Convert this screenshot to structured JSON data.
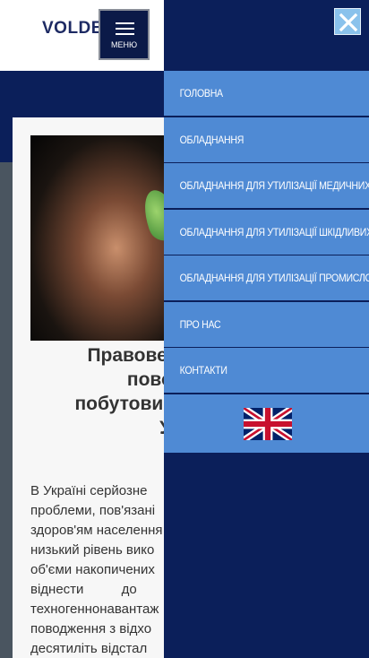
{
  "header": {
    "logo_text": "VOLDEMCA",
    "menu_label": "МЕНЮ"
  },
  "article": {
    "title_lines": [
      "Правове регулювання",
      "поводження з",
      "побутовими відходами в",
      "Україні"
    ],
    "body_lines": [
      "В Україні серйозне",
      "проблеми, пов'язані",
      "здоров'ям населення",
      "низький рівень вико",
      "об'єми накопичених",
      "віднести до",
      "техногеннонавантаж",
      "поводження з відхо",
      "десятиліть відстал"
    ]
  },
  "drawer": {
    "close_icon": "close-icon",
    "items": [
      {
        "label": "ГОЛОВНА"
      },
      {
        "label": "ОБЛАДНАННЯ"
      },
      {
        "label": "ОБЛАДНАННЯ ДЛЯ УТИЛІЗАЦІЇ МЕДИЧНИХ ВІДХОДІВ"
      },
      {
        "label": "ОБЛАДНАННЯ ДЛЯ УТИЛІЗАЦІЇ ШКІДЛИВИХ ВІДХОДІВ"
      },
      {
        "label": "ОБЛАДНАННЯ ДЛЯ УТИЛІЗАЦІЇ ПРОМИСЛОВИХ ВІДХОДІВ"
      },
      {
        "label": "ПРО НАС"
      },
      {
        "label": "КОНТАКТИ"
      }
    ],
    "language_flag": "uk-flag-icon"
  },
  "colors": {
    "drawer_bg": "#0b1f5a",
    "nav_item_bg": "#4f8ad4",
    "close_bg": "#8ac2ec",
    "logo": "#1d2a63"
  }
}
